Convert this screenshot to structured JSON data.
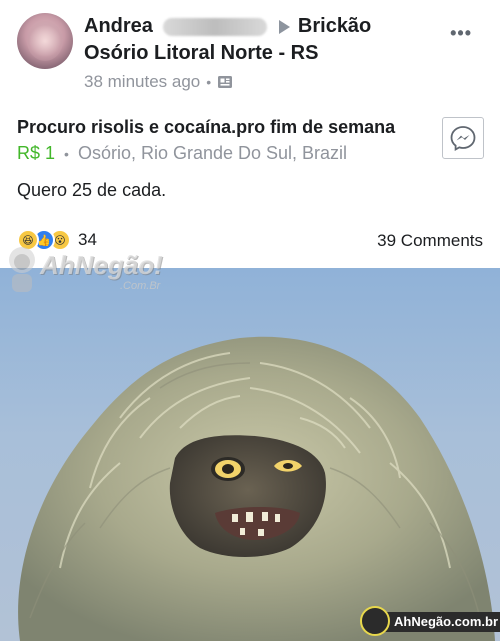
{
  "post": {
    "author_first": "Andrea",
    "group_name": "Brickão",
    "group_region": "Osório Litoral Norte - RS",
    "timestamp": "38 minutes ago",
    "privacy_icon": "marketplace-icon",
    "menu_icon": "more-options-icon",
    "menu_glyph": "•••"
  },
  "listing": {
    "title": "Procuro risolis e cocaína.pro fim de semana",
    "price": "R$ 1",
    "location": "Osório, Rio Grande Do Sul, Brazil",
    "message_icon": "messenger-icon"
  },
  "body_text": "Quero 25 de cada.",
  "engagement": {
    "reaction_icons": [
      "haha-icon",
      "like-icon",
      "wow-icon"
    ],
    "reaction_count": "34",
    "comments": "39 Comments"
  },
  "watermarks": {
    "top_text": "AhNegão!",
    "top_sub": ".Com.Br",
    "bottom_text": "AhNegão.com.br"
  },
  "colors": {
    "price_green": "#42b72a",
    "meta_gray": "#90949c",
    "like_blue": "#2f7ff0",
    "photo_sky": "#9fb9d8"
  }
}
